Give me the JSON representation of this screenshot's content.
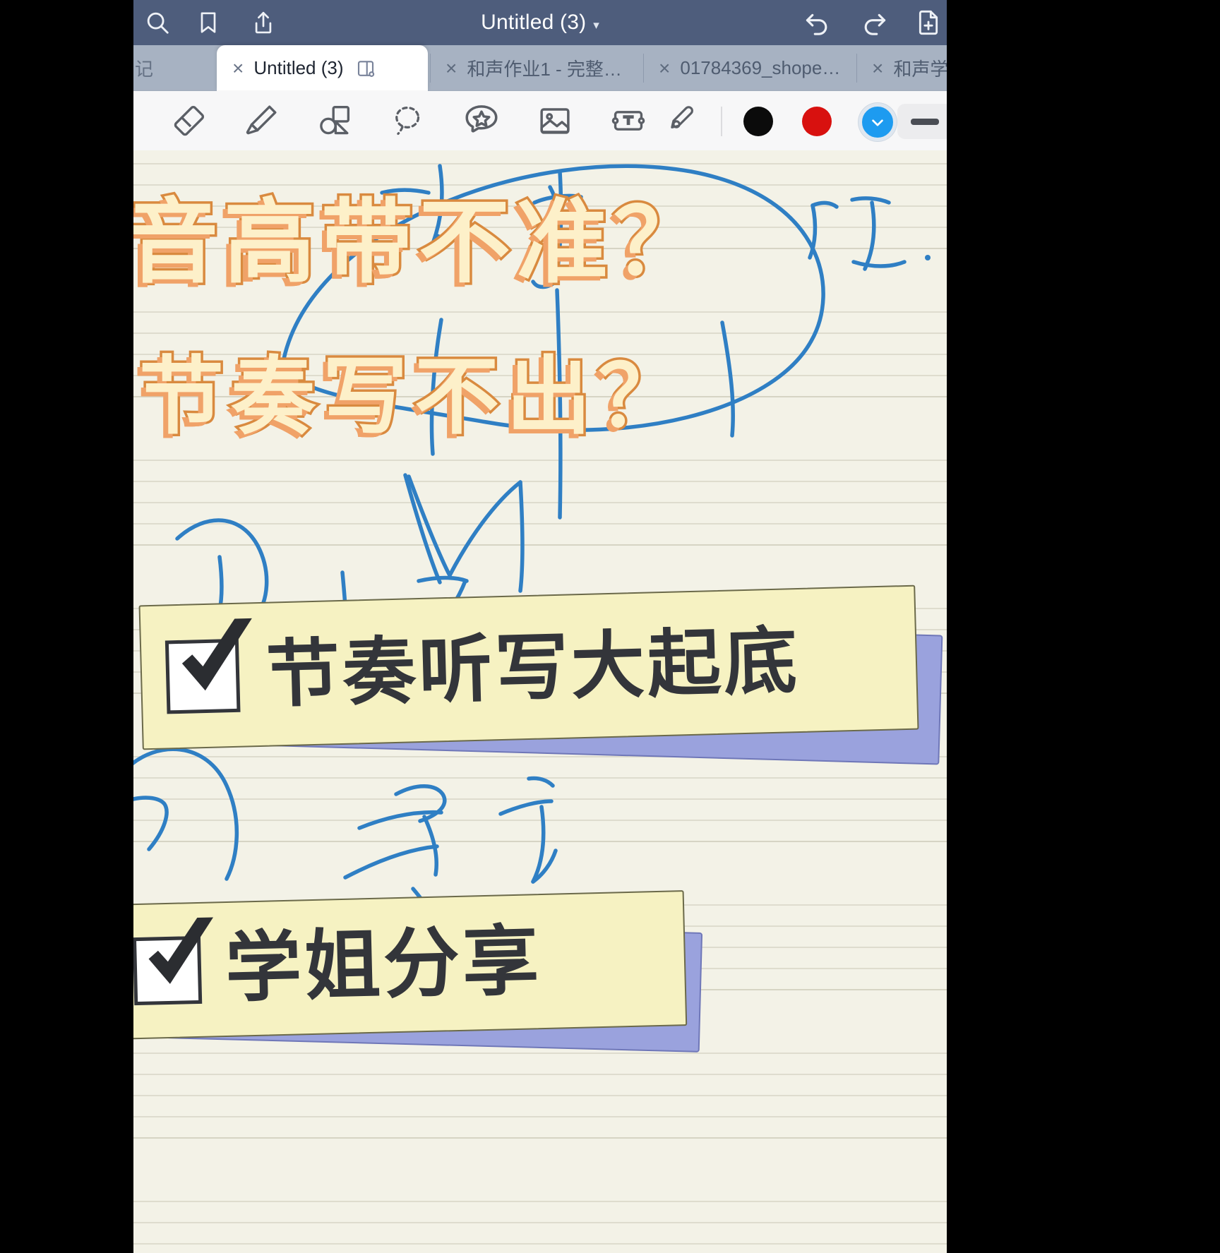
{
  "app": {
    "title": "Untitled (3)",
    "title_caret": "ˇ"
  },
  "topbar": {
    "icons": [
      {
        "name": "search-icon",
        "label": "Search"
      },
      {
        "name": "bookmark-icon",
        "label": "Bookmark"
      },
      {
        "name": "share-icon",
        "label": "Share"
      },
      {
        "name": "undo-icon",
        "label": "Undo"
      },
      {
        "name": "redo-icon",
        "label": "Redo"
      },
      {
        "name": "add-page-icon",
        "label": "New page"
      }
    ],
    "background": "#4e5d7c"
  },
  "tabs": {
    "close_glyph": "×",
    "items": [
      {
        "label": "记",
        "active": false,
        "truncated": true
      },
      {
        "label": "Untitled (3)",
        "active": true,
        "truncated": false
      },
      {
        "label": "和声作业1 - 完整…",
        "active": false,
        "truncated": true
      },
      {
        "label": "01784369_shope…",
        "active": false,
        "truncated": true
      },
      {
        "label": "和声学",
        "active": false,
        "truncated": true
      }
    ]
  },
  "toolbar": {
    "tools": [
      {
        "name": "eraser-tool",
        "label": "Eraser"
      },
      {
        "name": "highlighter-tool",
        "label": "Highlighter"
      },
      {
        "name": "shapes-tool",
        "label": "Shapes"
      },
      {
        "name": "lasso-tool",
        "label": "Lasso select"
      },
      {
        "name": "sticker-tool",
        "label": "Sticker"
      },
      {
        "name": "image-tool",
        "label": "Insert image"
      },
      {
        "name": "text-tool",
        "label": "Text box"
      },
      {
        "name": "eyedropper-tool",
        "label": "Color picker"
      }
    ],
    "colors": [
      {
        "name": "swatch-black",
        "hex": "#0b0b0b",
        "selected": false
      },
      {
        "name": "swatch-red",
        "hex": "#d8110f",
        "selected": false
      },
      {
        "name": "swatch-blue",
        "hex": "#1d9bf0",
        "selected": true
      }
    ],
    "stroke_width_label": "—"
  },
  "canvas": {
    "paper": "music-staff-paper",
    "paper_color": "#f3f2e7",
    "ink_color": "#2f7fc4",
    "headlines": [
      {
        "name": "headline-line-1",
        "text": "音高带不准？",
        "fill": "#fdf0c9",
        "outline": "#d98a3f",
        "shadow": "#f0a268"
      },
      {
        "name": "headline-line-2",
        "text": "节奏写不出？",
        "fill": "#fdf0c9",
        "outline": "#d98a3f",
        "shadow": "#f0a268"
      }
    ],
    "callouts": [
      {
        "name": "callout-rhythm-dictation",
        "text": "节奏听写大起底",
        "sheet_color": "#f6f2c2",
        "shadow_color": "#9aa2dd",
        "checkbox": "checked"
      },
      {
        "name": "callout-senior-share",
        "text": "学姐分享",
        "sheet_color": "#f6f2c2",
        "shadow_color": "#9aa2dd",
        "checkbox": "checked"
      }
    ],
    "handwriting": [
      {
        "name": "ink-char-ting",
        "text": "听"
      },
      {
        "name": "ink-char-ji",
        "text": "记"
      },
      {
        "name": "ink-char-yi",
        "text": "意"
      },
      {
        "name": "ink-char-yan",
        "text": "言"
      }
    ]
  }
}
